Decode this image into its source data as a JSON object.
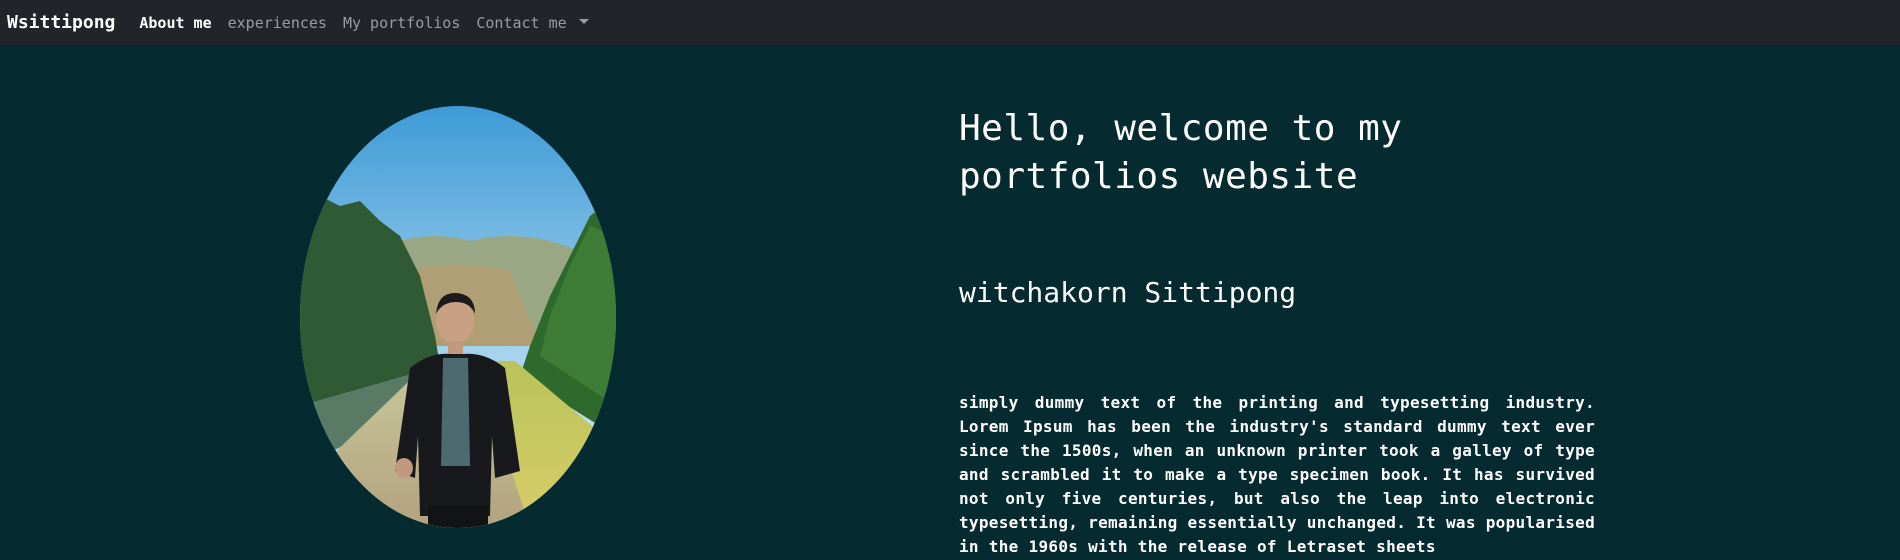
{
  "navbar": {
    "brand": "Wsittipong",
    "links": [
      {
        "label": "About me",
        "active": true
      },
      {
        "label": "experiences",
        "active": false
      },
      {
        "label": "My portfolios",
        "active": false
      },
      {
        "label": "Contact me",
        "active": false,
        "dropdown": true
      }
    ]
  },
  "hero": {
    "headline": "Hello, welcome to my portfolios website",
    "name": "witchakorn Sittipong",
    "bio": "simply dummy text of the printing and typesetting industry. Lorem Ipsum has been the industry's standard dummy text ever since the 1500s, when an unknown printer took a galley of type and scrambled it to make a type specimen book. It has survived not only five centuries, but also the leap into electronic typesetting, remaining essentially unchanged. It was popularised in the 1960s with the release of Letraset sheets"
  },
  "colors": {
    "navbar_bg": "#212529",
    "page_bg": "#052a30",
    "text": "#ffffff",
    "nav_inactive": "#9a9da0"
  }
}
